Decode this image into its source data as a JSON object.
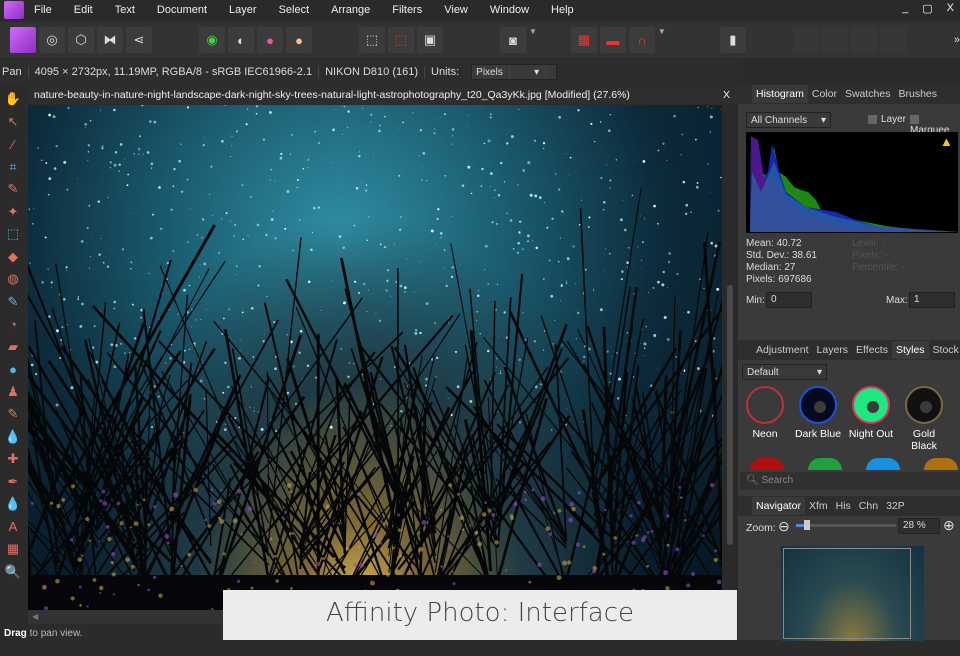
{
  "menu": [
    "File",
    "Edit",
    "Text",
    "Document",
    "Layer",
    "Select",
    "Arrange",
    "Filters",
    "View",
    "Window",
    "Help"
  ],
  "window_controls": [
    "_",
    "▢",
    "X"
  ],
  "context": {
    "tool": "Pan",
    "info": "4095 × 2732px, 11.19MP, RGBA/8 - sRGB IEC61966-2.1",
    "camera": "NIKON D810 (161)",
    "units_label": "Units:",
    "units_value": "Pixels"
  },
  "document": {
    "title": "nature-beauty-in-nature-night-landscape-dark-night-sky-trees-natural-light-astrophotography_t20_Qa3yKk.jpg [Modified] (27.6%)",
    "close": "X"
  },
  "histogram_panel": {
    "tabs": [
      "Histogram",
      "Color",
      "Swatches",
      "Brushes"
    ],
    "channel": "All Channels",
    "layer_label": "Layer",
    "marquee_label": "Marquee",
    "mean": "Mean: 40.72",
    "std": "Std. Dev.: 38.61",
    "median": "Median: 27",
    "pixels": "Pixels: 697686",
    "level": "Level: -",
    "pixels_sel": "Pixels: -",
    "percentile": "Percentile: -",
    "min_label": "Min:",
    "min_value": "0",
    "max_label": "Max:",
    "max_value": "1"
  },
  "styles_panel": {
    "tabs": [
      "Adjustment",
      "Layers",
      "Effects",
      "Styles",
      "Stock"
    ],
    "category": "Default",
    "items": [
      {
        "label": "Neon",
        "color": "#c0303a"
      },
      {
        "label": "Dark Blue",
        "color": "#0a1a60"
      },
      {
        "label": "Night Out",
        "color": "#20e880"
      },
      {
        "label": "Gold Black",
        "color": "#111111"
      }
    ],
    "search_placeholder": "Search"
  },
  "navigator_panel": {
    "tabs": [
      "Navigator",
      "Xfm",
      "His",
      "Chn",
      "32P"
    ],
    "zoom_label": "Zoom:",
    "zoom_value": "28 %",
    "zoom_fraction": 0.28
  },
  "status": {
    "bold": "Drag",
    "rest": " to pan view."
  },
  "caption": "Affinity Photo: Interface"
}
